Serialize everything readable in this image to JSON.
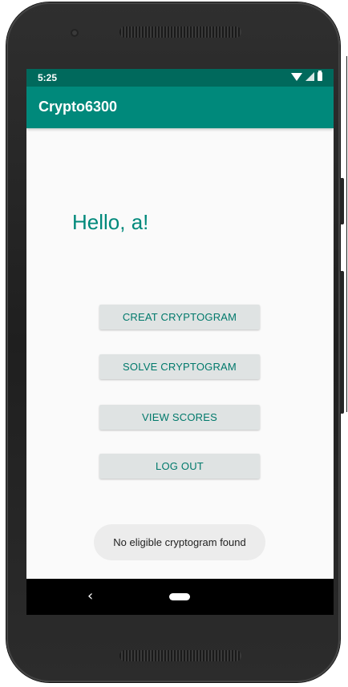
{
  "status_bar": {
    "time": "5:25",
    "icons": [
      "wifi-icon",
      "signal-icon",
      "battery-icon"
    ]
  },
  "app_bar": {
    "title": "Crypto6300"
  },
  "main": {
    "greeting": "Hello, a!",
    "buttons": {
      "create": "CREAT CRYPTOGRAM",
      "solve": "SOLVE CRYPTOGRAM",
      "scores": "VIEW SCORES",
      "logout": "LOG OUT"
    }
  },
  "toast": {
    "message": "No eligible cryptogram found"
  },
  "nav_bar": {
    "back_symbol": "‹",
    "icons": [
      "back-icon",
      "home-icon"
    ]
  },
  "colors": {
    "primary": "#00897b",
    "primary_dark": "#00695c",
    "button_bg": "#dfe3e3",
    "button_text": "#00796b",
    "screen_bg": "#fafafa"
  }
}
